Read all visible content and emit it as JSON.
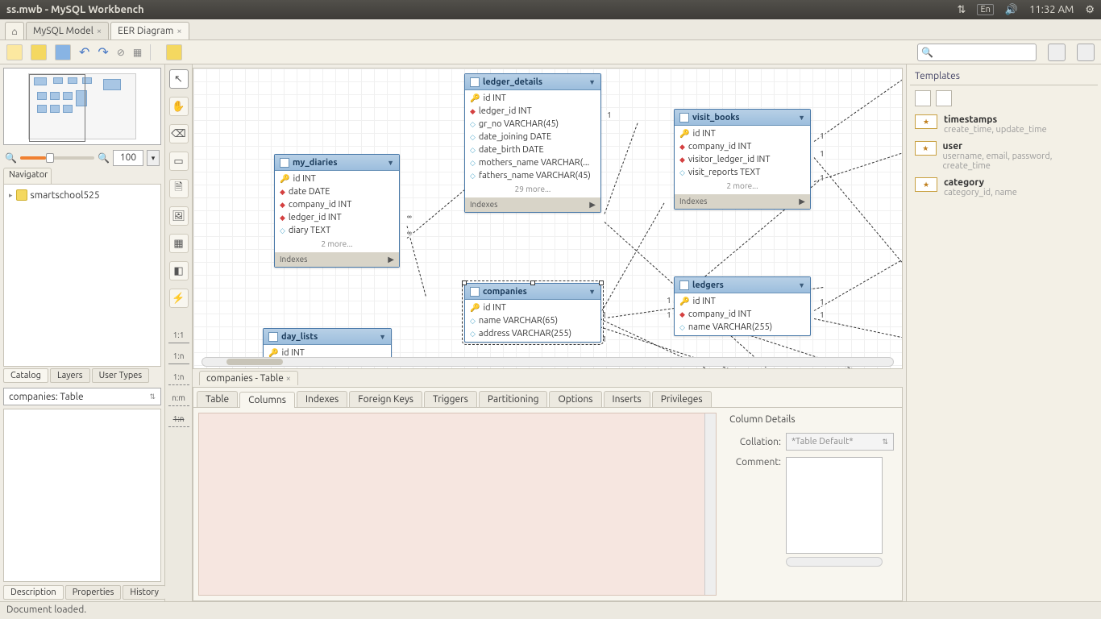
{
  "menubar": {
    "title": "ss.mwb - MySQL Workbench",
    "lang": "En",
    "time": "11:32 AM"
  },
  "doc_tabs": {
    "t0": "MySQL Model",
    "t1": "EER Diagram"
  },
  "zoom": {
    "value": "100"
  },
  "navigator_label": "Navigator",
  "catalog_db": "smartschool525",
  "left_tabs": {
    "catalog": "Catalog",
    "layers": "Layers",
    "usertypes": "User Types"
  },
  "prop_combo": "companies: Table",
  "desc_tabs": {
    "desc": "Description",
    "props": "Properties",
    "hist": "History"
  },
  "rel_labels": {
    "r0": "1:1",
    "r1": "1:n",
    "r2": "1:n",
    "r3": "n:m",
    "r4": "1:n"
  },
  "entities": {
    "my_diaries": {
      "name": "my_diaries",
      "more": "2 more...",
      "idx": "Indexes",
      "c0": "id INT",
      "c1": "date DATE",
      "c2": "company_id INT",
      "c3": "ledger_id INT",
      "c4": "diary TEXT"
    },
    "ledger_details": {
      "name": "ledger_details",
      "more": "29 more...",
      "idx": "Indexes",
      "c0": "id INT",
      "c1": "ledger_id INT",
      "c2": "gr_no VARCHAR(45)",
      "c3": "date_joining DATE",
      "c4": "date_birth DATE",
      "c5": "mothers_name VARCHAR(...",
      "c6": "fathers_name VARCHAR(45)"
    },
    "visit_books": {
      "name": "visit_books",
      "more": "2 more...",
      "idx": "Indexes",
      "c0": "id INT",
      "c1": "company_id INT",
      "c2": "visitor_ledger_id INT",
      "c3": "visit_reports TEXT"
    },
    "companies": {
      "name": "companies",
      "c0": "id INT",
      "c1": "name VARCHAR(65)",
      "c2": "address VARCHAR(255)"
    },
    "ledgers": {
      "name": "ledgers",
      "c0": "id INT",
      "c1": "company_id INT",
      "c2": "name VARCHAR(255)"
    },
    "day_lists": {
      "name": "day_lists",
      "c0": "id INT"
    }
  },
  "card_labels": {
    "one": "1",
    "many": "∞"
  },
  "bottom": {
    "tab": "companies - Table",
    "tabs": {
      "table": "Table",
      "columns": "Columns",
      "indexes": "Indexes",
      "fk": "Foreign Keys",
      "triggers": "Triggers",
      "part": "Partitioning",
      "options": "Options",
      "inserts": "Inserts",
      "priv": "Privileges"
    },
    "details_hdr": "Column Details",
    "collation_lbl": "Collation:",
    "collation_val": "*Table Default*",
    "comment_lbl": "Comment:"
  },
  "templates": {
    "hdr": "Templates",
    "t0n": "timestamps",
    "t0s": "create_time, update_time",
    "t1n": "user",
    "t1s": "username, email, password, create_time",
    "t2n": "category",
    "t2s": "category_id, name"
  },
  "status": "Document loaded."
}
